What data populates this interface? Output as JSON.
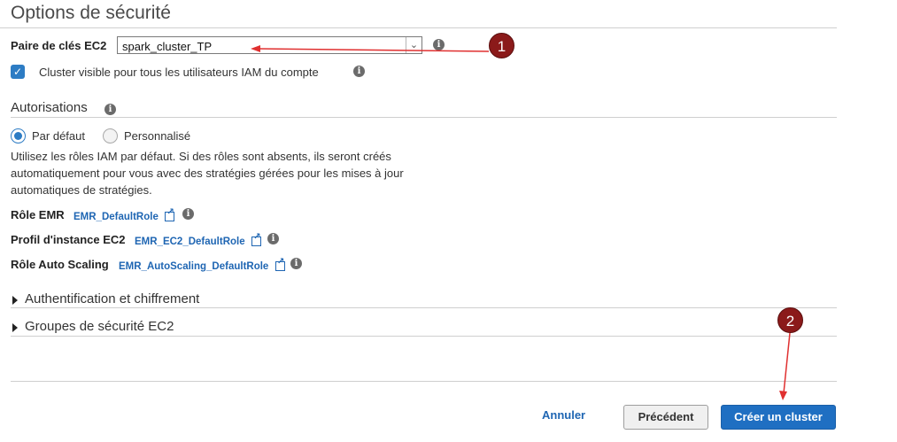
{
  "section_title": "Options de sécurité",
  "key_pair": {
    "label": "Paire de clés EC2",
    "selected": "spark_cluster_TP"
  },
  "visibility_checkbox": {
    "checked": true,
    "label": "Cluster visible pour tous les utilisateurs IAM du compte"
  },
  "permissions": {
    "title": "Autorisations",
    "options": [
      {
        "label": "Par défaut",
        "selected": true
      },
      {
        "label": "Personnalisé",
        "selected": false
      }
    ],
    "description": "Utilisez les rôles IAM par défaut. Si des rôles sont absents, ils seront créés automatiquement pour vous avec des stratégies gérées pour les mises à jour automatiques de stratégies.",
    "roles": [
      {
        "label": "Rôle EMR",
        "value": "EMR_DefaultRole"
      },
      {
        "label": "Profil d'instance EC2",
        "value": "EMR_EC2_DefaultRole"
      },
      {
        "label": "Rôle Auto Scaling",
        "value": "EMR_AutoScaling_DefaultRole"
      }
    ]
  },
  "collapsed_sections": [
    {
      "label": "Authentification et chiffrement"
    },
    {
      "label": "Groupes de sécurité EC2"
    }
  ],
  "footer": {
    "cancel": "Annuler",
    "previous": "Précédent",
    "create": "Créer un cluster"
  },
  "annotations": [
    {
      "number": "1"
    },
    {
      "number": "2"
    }
  ],
  "colors": {
    "primary": "#1f6fc2",
    "link": "#1f66b3",
    "annotation_badge": "#8b1a1a",
    "annotation_arrow": "#e03030"
  }
}
